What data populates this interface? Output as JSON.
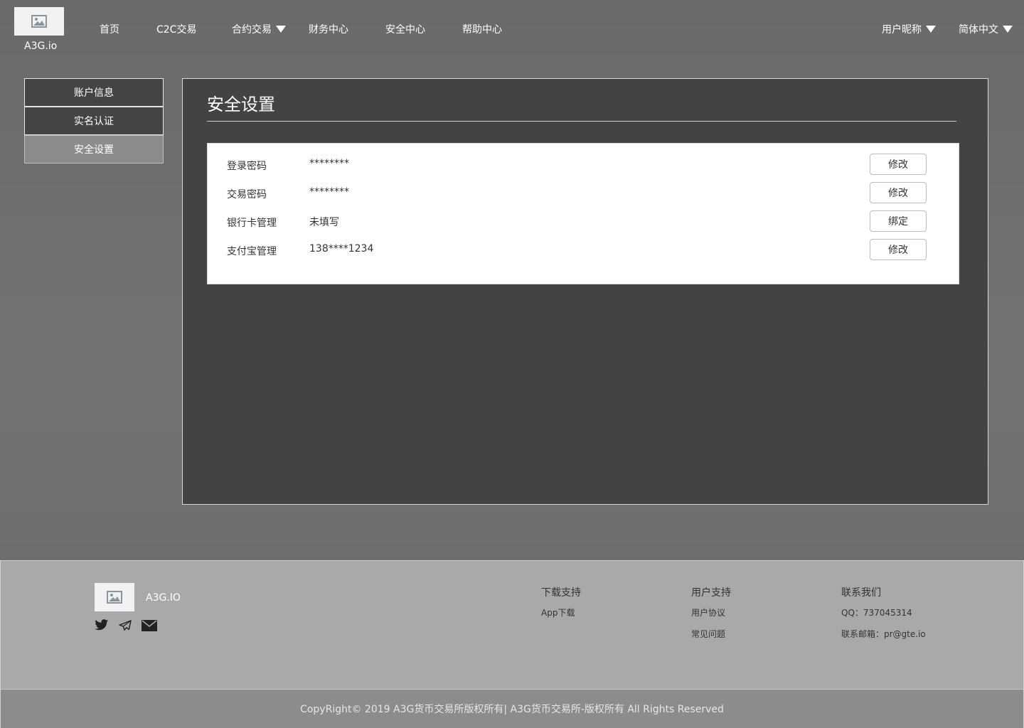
{
  "header": {
    "logo_text": "A3G.io",
    "nav": [
      {
        "label": "首页",
        "has_dropdown": false
      },
      {
        "label": "C2C交易",
        "has_dropdown": false
      },
      {
        "label": "合约交易",
        "has_dropdown": true
      },
      {
        "label": "财务中心",
        "has_dropdown": false
      },
      {
        "label": "安全中心",
        "has_dropdown": false
      },
      {
        "label": "帮助中心",
        "has_dropdown": false
      }
    ],
    "user_menu": "用户昵称",
    "language": "简体中文"
  },
  "sidebar": {
    "items": [
      {
        "label": "账户信息",
        "active": false
      },
      {
        "label": "实名认证",
        "active": false
      },
      {
        "label": "安全设置",
        "active": true
      }
    ]
  },
  "main": {
    "title": "安全设置",
    "rows": [
      {
        "label": "登录密码",
        "value": "********",
        "button": "修改"
      },
      {
        "label": "交易密码",
        "value": "********",
        "button": "修改"
      },
      {
        "label": "银行卡管理",
        "value": "未填写",
        "button": "绑定"
      },
      {
        "label": "支付宝管理",
        "value": "138****1234",
        "button": "修改"
      }
    ]
  },
  "footer": {
    "brand": "A3G.IO",
    "social_icons": [
      "twitter-icon",
      "telegram-icon",
      "email-icon"
    ],
    "columns": [
      {
        "title": "下载支持",
        "links": [
          "App下载"
        ]
      },
      {
        "title": "用户支持",
        "links": [
          "用户协议",
          "常见问题"
        ]
      },
      {
        "title": "联系我们",
        "links": [
          "QQ：737045314",
          "联系邮箱：pr@gte.io"
        ]
      }
    ],
    "copyright": "CopyRight© 2019 A3G货币交易所版权所有| A3G货币交易所-版权所有 All Rights Reserved"
  },
  "colors": {
    "page_bg": "#6d6d6d",
    "panel_bg": "#434343",
    "sidebar_active": "#8c8c8c",
    "footer_bg": "#a9a9a9",
    "copyright_bg": "#8c8c8c"
  }
}
